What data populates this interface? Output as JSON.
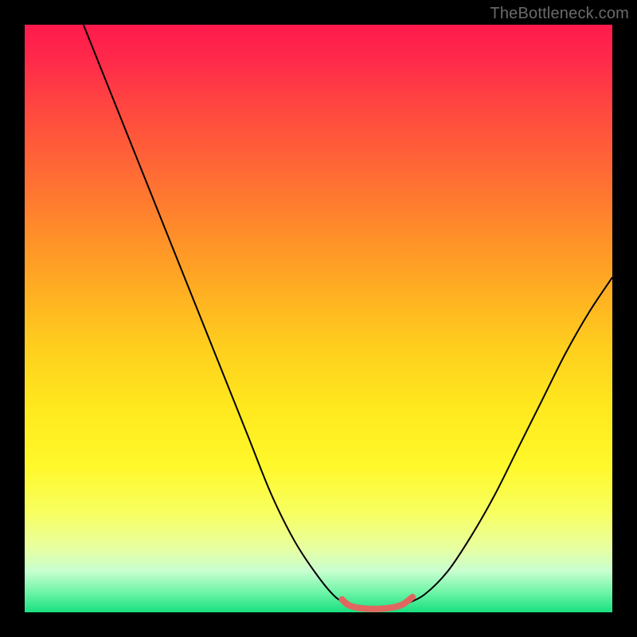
{
  "watermark": "TheBottleneck.com",
  "chart_data": {
    "type": "line",
    "title": "",
    "xlabel": "",
    "ylabel": "",
    "xlim": [
      0,
      100
    ],
    "ylim": [
      0,
      100
    ],
    "grid": false,
    "series": [
      {
        "name": "curve-left",
        "stroke": "#000000",
        "stroke_width": 2,
        "x": [
          10,
          14,
          18,
          22,
          26,
          30,
          34,
          38,
          42,
          46,
          50,
          53,
          55
        ],
        "y": [
          100,
          90,
          80,
          70,
          60,
          50,
          40,
          30,
          20,
          12,
          6,
          2.5,
          1.5
        ]
      },
      {
        "name": "curve-right",
        "stroke": "#000000",
        "stroke_width": 2,
        "x": [
          65,
          68,
          72,
          76,
          80,
          84,
          88,
          92,
          96,
          100
        ],
        "y": [
          1.5,
          3,
          7,
          13,
          20,
          28,
          36,
          44,
          51,
          57
        ]
      },
      {
        "name": "optimal-segment",
        "stroke": "#e0675f",
        "stroke_width": 8,
        "linecap": "round",
        "x": [
          54,
          55,
          56.5,
          58.5,
          60.5,
          62.5,
          64,
          65,
          66
        ],
        "y": [
          2.2,
          1.3,
          0.8,
          0.6,
          0.6,
          0.8,
          1.2,
          1.8,
          2.6
        ]
      }
    ],
    "background_gradient": {
      "top": "#ff1a4d",
      "mid": "#ffe81e",
      "bottom": "#18e080"
    }
  }
}
